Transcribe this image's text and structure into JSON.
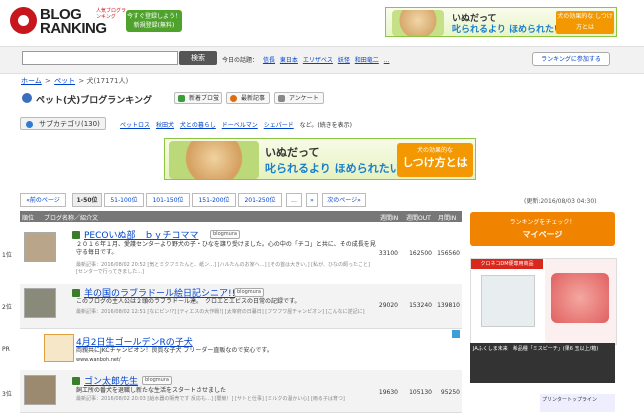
{
  "logo": {
    "line1": "BLOG",
    "line2": "RANKING",
    "tagline": "人気ブログランキング"
  },
  "register_button": {
    "line1": "今すぐ登録しよう！",
    "line2": "新規登録(無料)"
  },
  "top_ad": {
    "line1": "いぬだって",
    "line2": "叱られるより ほめられたいの。",
    "badge": "犬の効果的な しつけ方とは"
  },
  "search": {
    "placeholder": "",
    "button": "検索",
    "today_label": "今日の話題：",
    "keywords": [
      "信長",
      "東日本",
      "エリザベス",
      "妖怪",
      "和田竜二",
      "..."
    ],
    "join_button": "ランキングに参加する"
  },
  "breadcrumb": {
    "home": "ホーム",
    "pet": "ペット",
    "current": "犬(17171人)"
  },
  "page": {
    "title": "ペット(犬)ブログランキング",
    "tab_new": "新着ブロ蛍",
    "tab_latest": "最新記事",
    "tab_survey": "アンケート"
  },
  "subcategory": {
    "button": "サブカテゴリ(130)",
    "links": [
      "ペットロス",
      "秋田犬",
      "犬との暮らし",
      "ドーベルマン",
      "シェパード"
    ],
    "suffix": "など。(続きを表示)"
  },
  "mid_ad": {
    "line1": "いぬだって",
    "line2": "叱られるより ほめられたいの。",
    "badge_top": "犬の効果的な",
    "badge_main": "しつけ方とは"
  },
  "pagination": {
    "prev": "«前のページ",
    "pages": [
      "1-50位",
      "51-100位",
      "101-150位",
      "151-200位",
      "201-250位",
      "...",
      "»"
    ],
    "next": "次のページ»"
  },
  "updated": "(更新:2016/08/03 04:30)",
  "table": {
    "headers": [
      "順位",
      "ブログ名称／紹介文",
      "週間IN",
      "週間OUT",
      "月間IN"
    ]
  },
  "rows": [
    {
      "rank": "1位",
      "title": "PECOいぬ部　ｂｙチコママ",
      "desc": "２０１６年１月、愛護センターより野犬の子・ひなを譲り受けました。心の中の「チコ」と共に、その成長を見守る毎日です。",
      "latest": "最新記事：2016/08/02 20:52 [気とミクフミたんと、紙ン…] [ハルたんのお家へ…] [その首は大きい。] [私が、ひなの飼ったこと] [センターで行ってきました...]",
      "in": "33100",
      "out": "162500",
      "month": "156560"
    },
    {
      "rank": "2位",
      "title": "羊の国のラブラドール絵日記シニア!!",
      "desc": "このブログの主人公は２頭のラブラドール達。　クロエとエビスの日常の記録です。",
      "latest": "最新記事：2016/08/02 12:51 [なにピン!?] [ティエスの大作戦!] [太宰府の日暮日] [フワフワ屋チャンピオン] [こんなに逆記に]",
      "in": "29020",
      "out": "153240",
      "month": "139810"
    },
    {
      "rank": "PR",
      "title": "4月2日生ゴールデンRの子犬",
      "desc": "両親共にJKCチャンピオン！良質な子犬 ブリーダー直販なので安心です。",
      "latest": "www.wanboh.net/",
      "in": "",
      "out": "",
      "month": ""
    },
    {
      "rank": "3位",
      "title": "ゴン太郎先生",
      "desc": "飼工所の番犬を退職し新たな生活をスタートさせました",
      "latest": "最新記事：2016/08/02 20:03 [給水器の販売です 反応も…] [闇競！] [サトと仕事] [ミルクの温かい心] [雨る子は育つ]",
      "in": "19630",
      "out": "105130",
      "month": "95250"
    }
  ],
  "sidebar": {
    "check_line1": "ランキングをチェック！",
    "check_line2": "マイページ",
    "ad1_caption": "クロネコDM便専用商品",
    "ad2_caption": "JAふくしま未来　希品種「ミスピーチ」(果6 玉以上/箱)",
    "ad3": "プリンタートップライン"
  }
}
